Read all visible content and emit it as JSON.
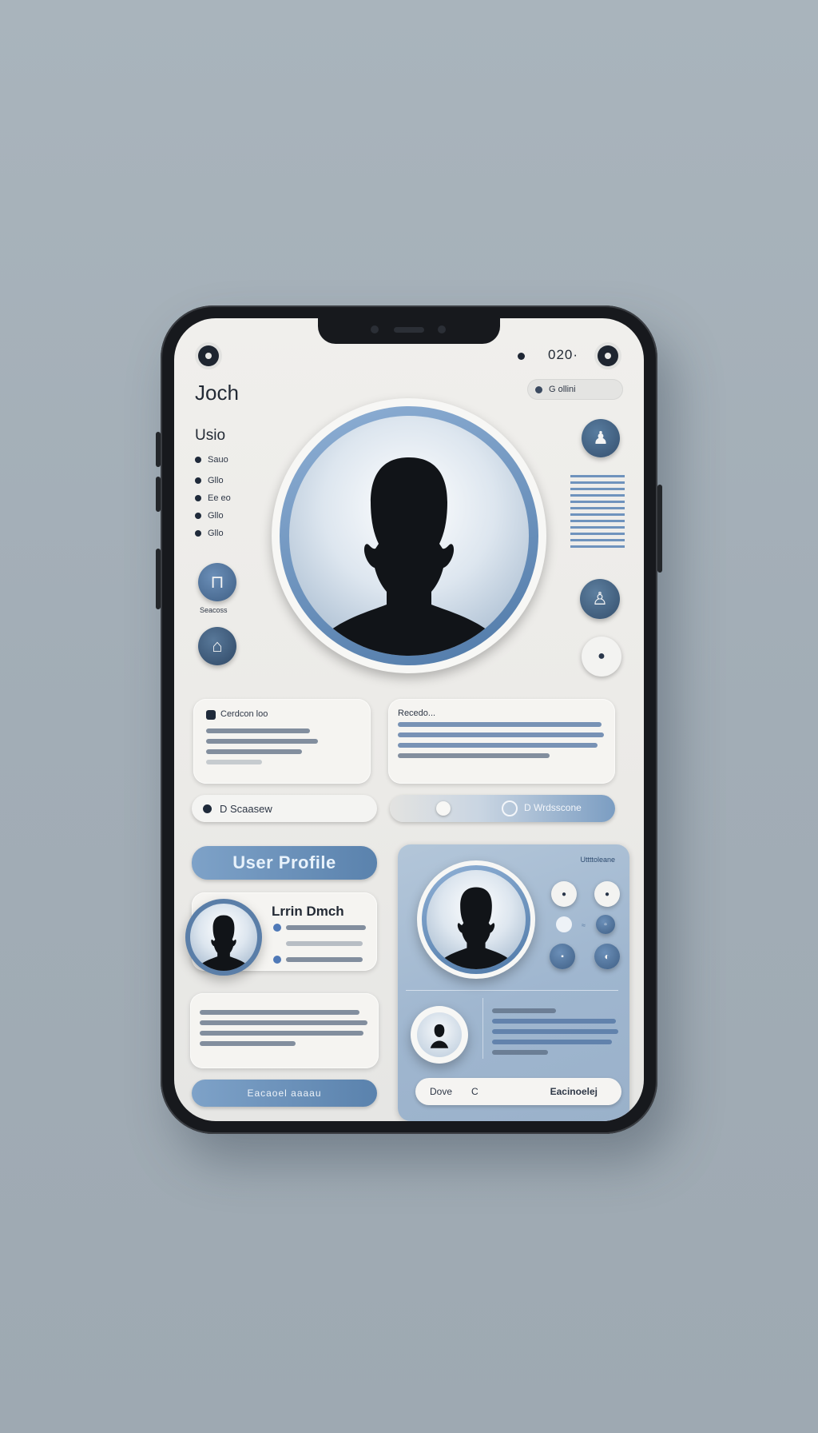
{
  "status": {
    "time": "020·"
  },
  "header": {
    "name": "Joch",
    "chip": "G ollini"
  },
  "sidebar": {
    "title": "Usio",
    "items": [
      {
        "label": "Sauo"
      },
      {
        "label": "Gllo"
      },
      {
        "label": "Ee eo"
      },
      {
        "label": "Gllo"
      },
      {
        "label": "Gllo"
      }
    ],
    "lock_label": "Seacoss"
  },
  "info_cards": {
    "left_title": "Cerdcon loo",
    "right_title": "Recedo..."
  },
  "pills": {
    "left_label": "D Scaasew",
    "right_label": "D Wrdsscone"
  },
  "section": {
    "title": "User Profile",
    "profile_name": "Lrrin Dmch",
    "panel_caption": "Uttttoleane"
  },
  "bottom": {
    "left_button": "Eacaoel aaaau",
    "right_button_left": "Dove",
    "right_button_mid": "C",
    "right_button_right": "Eacinoelej"
  },
  "colors": {
    "accent": "#5a82ad",
    "accent_light": "#7ea2c8",
    "text": "#232a35",
    "background": "#a9b4bc"
  }
}
